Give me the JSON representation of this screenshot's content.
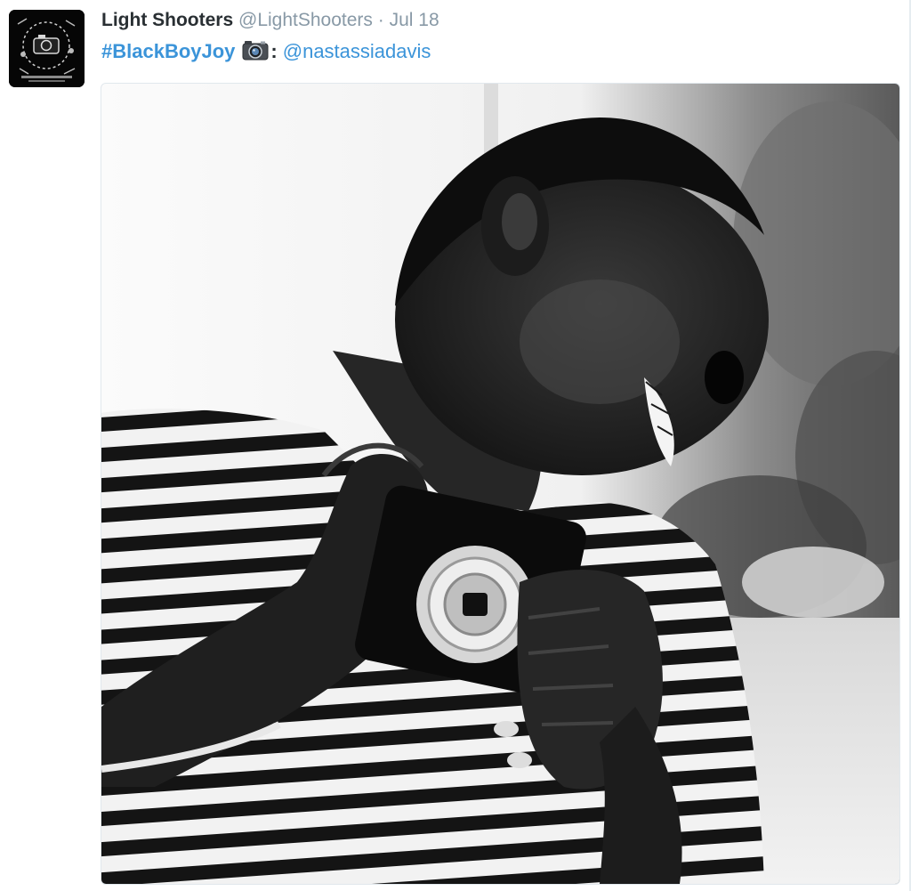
{
  "tweet": {
    "author_name": "Light Shooters",
    "author_handle": "@LightShooters",
    "separator": "·",
    "date": "Jul 18",
    "hashtag": "#BlackBoyJoy",
    "camera_icon": "camera-emoji",
    "colon": ":",
    "mention": "@nastassiadavis",
    "avatar_icon": "profile-avatar",
    "photo": "black-and-white photo of a smiling boy in a striped shirt holding a compact camera"
  },
  "colors": {
    "link": "#3b94d9",
    "name": "#292f33",
    "meta": "#8899a6"
  }
}
